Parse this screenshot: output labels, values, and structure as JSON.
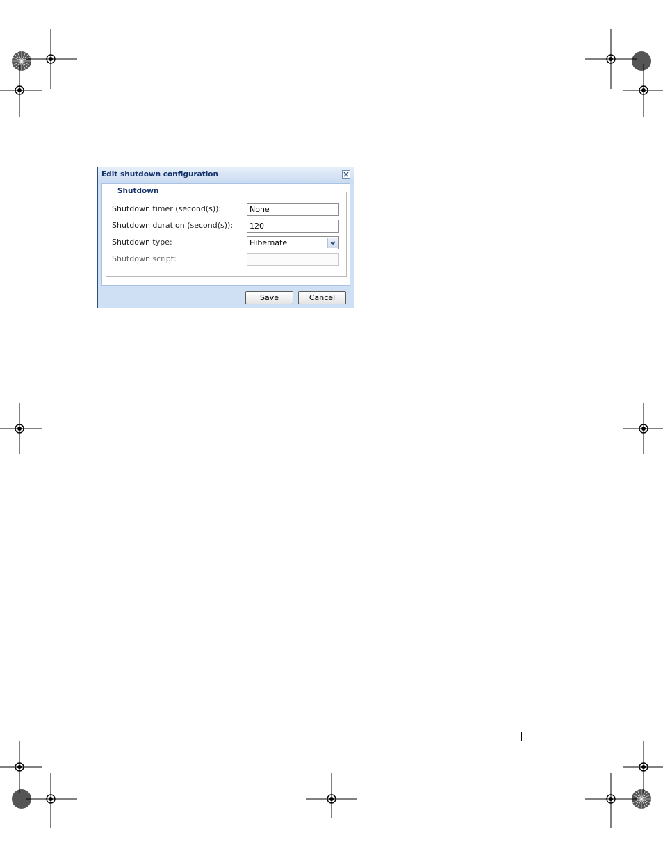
{
  "dialog": {
    "title": "Edit shutdown configuration",
    "close_icon": "close-icon",
    "section_title": "Shutdown",
    "fields": {
      "timer_label": "Shutdown timer (second(s)):",
      "timer_value": "None",
      "duration_label": "Shutdown duration (second(s)):",
      "duration_value": "120",
      "type_label": "Shutdown type:",
      "type_value": "Hibernate",
      "script_label": "Shutdown script:",
      "script_value": ""
    },
    "buttons": {
      "save": "Save",
      "cancel": "Cancel"
    }
  },
  "colors": {
    "title_text": "#15336b",
    "dialog_background": "#cfe0f5",
    "frame_border": "#2a4f7e"
  },
  "print_marks": {
    "crosshair_icon": "registration-crosshair-icon",
    "starburst_icon": "starburst-target-icon"
  }
}
